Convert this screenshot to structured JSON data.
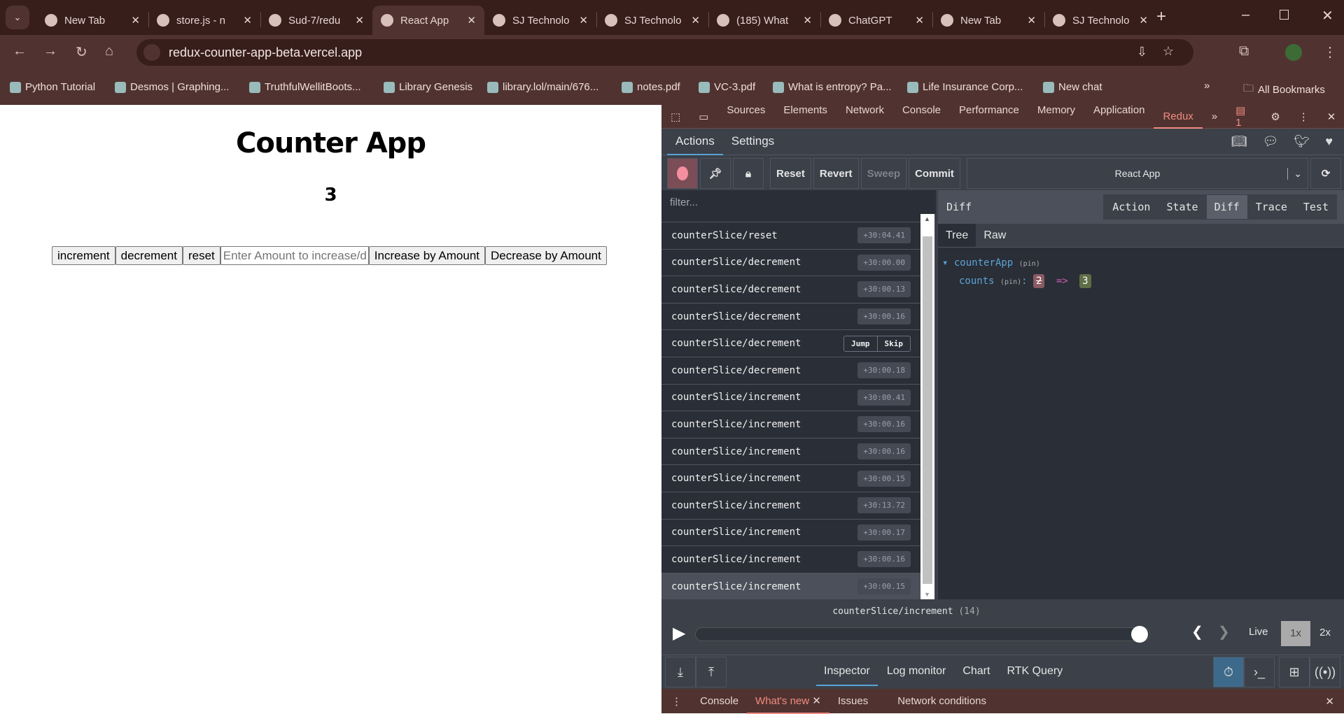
{
  "browser": {
    "tabs": [
      {
        "label": "New Tab"
      },
      {
        "label": "store.js - n"
      },
      {
        "label": "Sud-7/redu"
      },
      {
        "label": "React App",
        "active": true
      },
      {
        "label": "SJ Technolo"
      },
      {
        "label": "SJ Technolo"
      },
      {
        "label": "(185) What"
      },
      {
        "label": "ChatGPT"
      },
      {
        "label": "New Tab"
      },
      {
        "label": "SJ Technolo"
      }
    ],
    "url": "redux-counter-app-beta.vercel.app",
    "bookmarks": [
      "Python Tutorial",
      "Desmos | Graphing...",
      "TruthfulWellitBoots...",
      "Library Genesis",
      "library.lol/main/676...",
      "notes.pdf",
      "VC-3.pdf",
      "What is entropy? Pa...",
      "Life Insurance Corp...",
      "New chat"
    ],
    "all_bookmarks": "All Bookmarks"
  },
  "app": {
    "title": "Counter App",
    "count": "3",
    "buttons": {
      "increment": "increment",
      "decrement": "decrement",
      "reset": "reset",
      "increase": "Increase by Amount",
      "decrease": "Decrease by Amount"
    },
    "amount_placeholder": "Enter Amount to increase/decrease"
  },
  "devtools": {
    "tabs": [
      "Sources",
      "Elements",
      "Network",
      "Console",
      "Performance",
      "Memory",
      "Application",
      "Redux"
    ],
    "issues_count": "1",
    "redux": {
      "top_tabs": [
        "Actions",
        "Settings"
      ],
      "toolbar": {
        "reset": "Reset",
        "revert": "Revert",
        "sweep": "Sweep",
        "commit": "Commit",
        "instance": "React App"
      },
      "filter_placeholder": "filter...",
      "actions": [
        {
          "name": "counterSlice/reset",
          "time": "+30:04.41"
        },
        {
          "name": "counterSlice/decrement",
          "time": "+30:00.00"
        },
        {
          "name": "counterSlice/decrement",
          "time": "+30:00.13"
        },
        {
          "name": "counterSlice/decrement",
          "time": "+30:00.16"
        },
        {
          "name": "counterSlice/decrement",
          "time": "",
          "hover": true
        },
        {
          "name": "counterSlice/decrement",
          "time": "+30:00.18"
        },
        {
          "name": "counterSlice/increment",
          "time": "+30:00.41"
        },
        {
          "name": "counterSlice/increment",
          "time": "+30:00.16"
        },
        {
          "name": "counterSlice/increment",
          "time": "+30:00.16"
        },
        {
          "name": "counterSlice/increment",
          "time": "+30:00.15"
        },
        {
          "name": "counterSlice/increment",
          "time": "+30:13.72"
        },
        {
          "name": "counterSlice/increment",
          "time": "+30:00.17"
        },
        {
          "name": "counterSlice/increment",
          "time": "+30:00.16"
        },
        {
          "name": "counterSlice/increment",
          "time": "+30:00.15",
          "selected": true
        }
      ],
      "jump": "Jump",
      "skip": "Skip",
      "panel_title": "Diff",
      "monitor_tabs": [
        "Action",
        "State",
        "Diff",
        "Trace",
        "Test"
      ],
      "view_tabs": [
        "Tree",
        "Raw"
      ],
      "diff": {
        "root": "counterApp",
        "key": "counts",
        "pin": "(pin)",
        "old": "2",
        "arrow": "=>",
        "new": "3"
      },
      "slider": {
        "label": "counterSlice/increment",
        "index": "(14)",
        "position": 1.0,
        "live": "Live",
        "speed1": "1x",
        "speed2": "2x"
      },
      "bottom_tabs": [
        "Inspector",
        "Log monitor",
        "Chart",
        "RTK Query"
      ]
    },
    "drawer": [
      "Console",
      "What's new",
      "Issues",
      "Network conditions"
    ]
  }
}
